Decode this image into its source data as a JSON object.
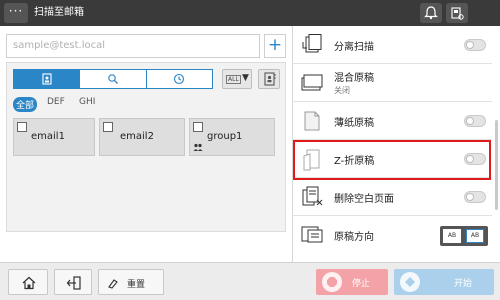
{
  "colors": {
    "accent": "#2a86c7",
    "highlight": "#e01b1b",
    "stop": "#f3a3a8",
    "start": "#aad0ec"
  },
  "header": {
    "menu_label": "···",
    "title": "扫描至邮箱"
  },
  "address": {
    "placeholder": "sample@test.local",
    "add_label": "+"
  },
  "filter": {
    "all_badge": "ALL",
    "caret": "▼"
  },
  "index_tabs": [
    "全部",
    "DEF",
    "GHI"
  ],
  "destinations": [
    {
      "label": "email1"
    },
    {
      "label": "email2"
    },
    {
      "label": "group1"
    }
  ],
  "settings": [
    {
      "label": "分离扫描",
      "toggle": "off",
      "icon": "separate-scan-icon"
    },
    {
      "label": "混合原稿",
      "sub": "关闭",
      "icon": "mixed-original-icon"
    },
    {
      "label": "薄纸原稿",
      "toggle": "off",
      "icon": "thin-paper-icon"
    },
    {
      "label": "Z-折原稿",
      "toggle": "off",
      "icon": "z-fold-icon"
    },
    {
      "label": "删除空白页面",
      "toggle": "off",
      "icon": "blank-page-removal-icon"
    },
    {
      "label": "原稿方向",
      "icon": "original-direction-icon"
    }
  ],
  "orientation": {
    "a": "AB",
    "b": "AB"
  },
  "footer": {
    "reset_label": "重置",
    "stop_label": "停止",
    "start_label": "开始"
  }
}
